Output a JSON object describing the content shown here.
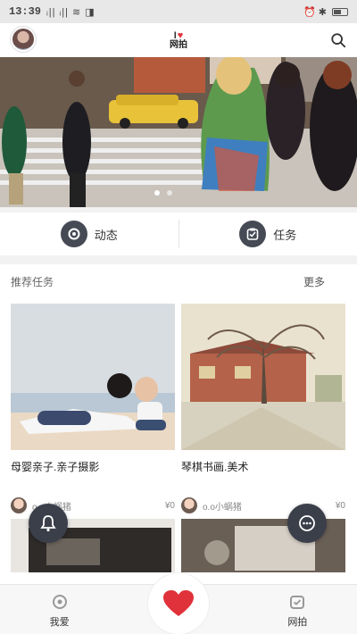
{
  "status": {
    "time": "13:39",
    "signal": "ᵢ|| ᵢ|| ≋ ◨",
    "right_icons": "⏰ ✱"
  },
  "header": {
    "logo_top": "I",
    "logo_text": "网拍"
  },
  "quicknav": [
    {
      "label": "动态"
    },
    {
      "label": "任务"
    }
  ],
  "section": {
    "title": "推荐任务",
    "more": "更多"
  },
  "cards": [
    {
      "title": "母婴亲子.亲子摄影",
      "user": "o.o小蜗猪",
      "price": "¥0"
    },
    {
      "title": "琴棋书画.美术",
      "user": "o.o小蜗猪",
      "price": "¥0"
    }
  ],
  "tabs": {
    "left": "我爱",
    "right": "网拍"
  },
  "colors": {
    "accent": "#e0323a",
    "dark": "#3b3f4a"
  }
}
